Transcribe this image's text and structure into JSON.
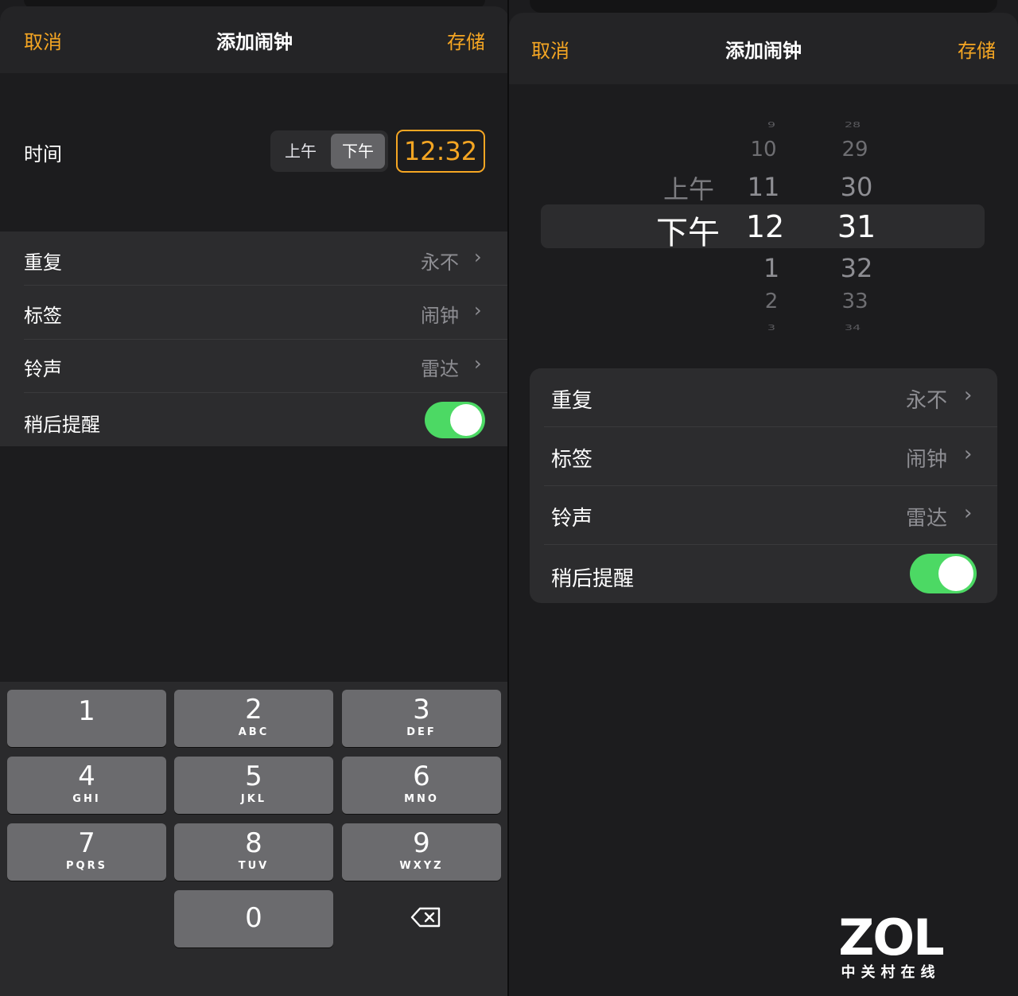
{
  "left": {
    "nav": {
      "cancel": "取消",
      "title": "添加闹钟",
      "save": "存储"
    },
    "time": {
      "label": "时间",
      "am": "上午",
      "pm": "下午",
      "value": "12:32"
    },
    "rows": [
      {
        "label": "重复",
        "value": "永不"
      },
      {
        "label": "标签",
        "value": "闹钟"
      },
      {
        "label": "铃声",
        "value": "雷达"
      },
      {
        "label": "稍后提醒",
        "toggle": true
      }
    ],
    "keypad": [
      {
        "digit": "1",
        "letters": ""
      },
      {
        "digit": "2",
        "letters": "ABC"
      },
      {
        "digit": "3",
        "letters": "DEF"
      },
      {
        "digit": "4",
        "letters": "GHI"
      },
      {
        "digit": "5",
        "letters": "JKL"
      },
      {
        "digit": "6",
        "letters": "MNO"
      },
      {
        "digit": "7",
        "letters": "PQRS"
      },
      {
        "digit": "8",
        "letters": "TUV"
      },
      {
        "digit": "9",
        "letters": "WXYZ"
      },
      {
        "digit": "0",
        "letters": ""
      }
    ]
  },
  "right": {
    "nav": {
      "cancel": "取消",
      "title": "添加闹钟",
      "save": "存储"
    },
    "picker": {
      "ampm": [
        "上午",
        "下午"
      ],
      "hours": [
        "9",
        "10",
        "11",
        "12",
        "1",
        "2",
        "3"
      ],
      "minutes": [
        "28",
        "29",
        "30",
        "31",
        "32",
        "33",
        "34"
      ]
    },
    "rows": [
      {
        "label": "重复",
        "value": "永不"
      },
      {
        "label": "标签",
        "value": "闹钟"
      },
      {
        "label": "铃声",
        "value": "雷达"
      },
      {
        "label": "稍后提醒",
        "toggle": true
      }
    ]
  },
  "watermark": {
    "brand": "ZOL",
    "subtitle": "中关村在线"
  },
  "colors": {
    "accent": "#f5a623",
    "toggle_on": "#4cd964",
    "background": "#1c1c1e",
    "cell": "#2c2c2e"
  }
}
